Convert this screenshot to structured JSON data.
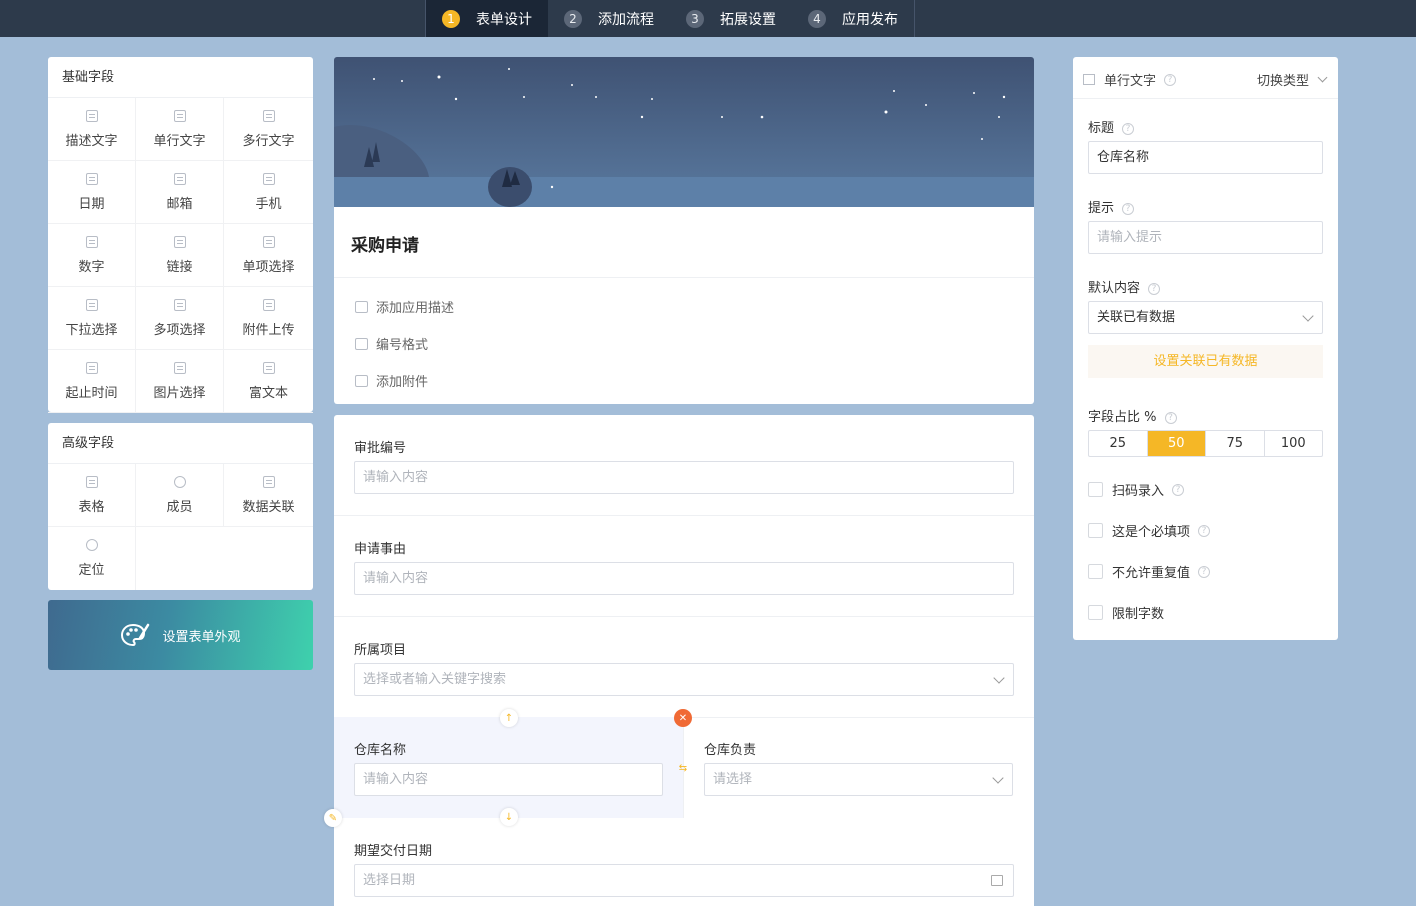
{
  "steps": [
    {
      "num": "1",
      "label": "表单设计"
    },
    {
      "num": "2",
      "label": "添加流程"
    },
    {
      "num": "3",
      "label": "拓展设置"
    },
    {
      "num": "4",
      "label": "应用发布"
    }
  ],
  "basic": {
    "title": "基础字段",
    "items": [
      "描述文字",
      "单行文字",
      "多行文字",
      "日期",
      "邮箱",
      "手机",
      "数字",
      "链接",
      "单项选择",
      "下拉选择",
      "多项选择",
      "附件上传",
      "起止时间",
      "图片选择",
      "富文本"
    ]
  },
  "advanced": {
    "title": "高级字段",
    "items": [
      "表格",
      "成员",
      "数据关联",
      "定位"
    ]
  },
  "appearance_label": "设置表单外观",
  "form": {
    "title": "采购申请",
    "links": [
      "添加应用描述",
      "编号格式",
      "添加附件"
    ],
    "fields": [
      {
        "label": "审批编号",
        "placeholder": "请输入内容"
      },
      {
        "label": "申请事由",
        "placeholder": "请输入内容"
      },
      {
        "label": "所属项目",
        "placeholder": "选择或者输入关键字搜索"
      },
      {
        "label": "仓库名称",
        "placeholder": "请输入内容"
      },
      {
        "label": "仓库负责",
        "placeholder": "请选择"
      },
      {
        "label": "期望交付日期",
        "placeholder": "选择日期"
      }
    ]
  },
  "props": {
    "type": "单行文字",
    "switch": "切换类型",
    "title_label": "标题",
    "title_value": "仓库名称",
    "hint_label": "提示",
    "hint_placeholder": "请输入提示",
    "default_label": "默认内容",
    "default_value": "关联已有数据",
    "set_button": "设置关联已有数据",
    "ratio_label": "字段占比 %",
    "ratios": [
      "25",
      "50",
      "75",
      "100"
    ],
    "ratio_selected": "50",
    "checks": [
      "扫码录入",
      "这是个必填项",
      "不允许重复值",
      "限制字数"
    ]
  },
  "colors": {
    "accent": "#f5b726",
    "topbar": "#2d3a4b",
    "background": "#a3bdd8",
    "delete": "#f06a35"
  }
}
